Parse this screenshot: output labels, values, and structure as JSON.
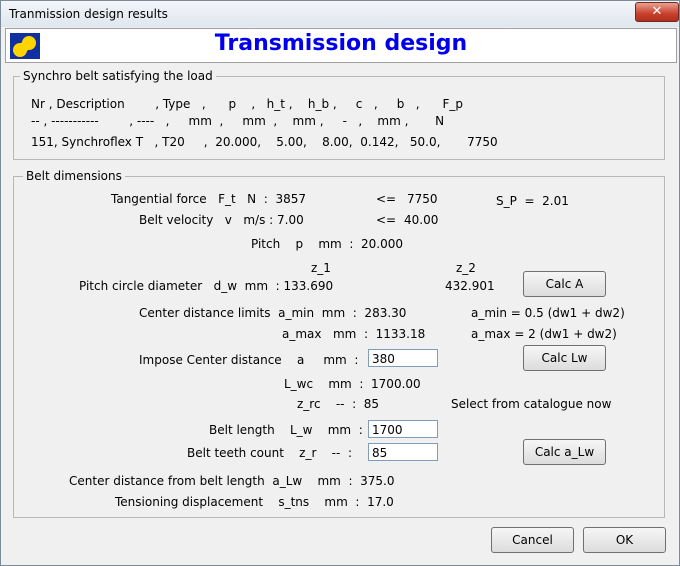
{
  "window": {
    "title": "Tranmission design results",
    "close": "✕"
  },
  "header": {
    "title": "Transmission design"
  },
  "synchro": {
    "legend": "Synchro belt satisfying the load",
    "row_headers": "Nr , Description        , Type   ,      p    ,   h_t ,    h_b ,     c   ,     b   ,      F_p",
    "row_units": "-- , -----------        , ----   ,     mm  ,     mm  ,    mm ,     -   ,    mm ,       N",
    "row_values": "151, Synchroflex T   , T20     ,  20.000,    5.00,    8.00,  0.142,   50.0,       7750"
  },
  "dims": {
    "legend": "Belt dimensions",
    "tangential_label": "Tangential force   F_t   N  :  3857",
    "tangential_le": "<=",
    "tangential_max": "7750",
    "sp": "S_P  =  2.01",
    "velocity_label": "Belt velocity   v   m/s : 7.00",
    "velocity_le": "<=",
    "velocity_max": "40.00",
    "pitch": "Pitch    p    mm  :  20.000",
    "z1": "z_1",
    "z2": "z_2",
    "pcd_label": "Pitch circle diameter   d_w  mm  : 133.690",
    "pcd2": "432.901",
    "calc_a": "Calc A",
    "amin": "Center distance limits  a_min  mm  :  283.30",
    "amin_formula": "a_min = 0.5 (dw1 + dw2)",
    "amax": "a_max   mm  :  1133.18",
    "amax_formula": "a_max = 2 (dw1 + dw2)",
    "impose_label": "Impose Center distance    a     mm  :",
    "impose_value": "380",
    "calc_lw": "Calc Lw",
    "lwc": "L_wc    mm  :  1700.00",
    "zrc": "z_rc    --  :  85",
    "select_note": "Select from catalogue now",
    "belt_length_label": "Belt length    L_w    mm  :",
    "belt_length_value": "1700",
    "teeth_label": "Belt teeth count    z_r    --  :",
    "teeth_value": "85",
    "calc_alw": "Calc a_Lw",
    "cd_belt": "Center distance from belt length  a_Lw    mm  :  375.0",
    "tension": "Tensioning displacement    s_tns    mm  :  17.0"
  },
  "footer": {
    "cancel": "Cancel",
    "ok": "OK"
  }
}
